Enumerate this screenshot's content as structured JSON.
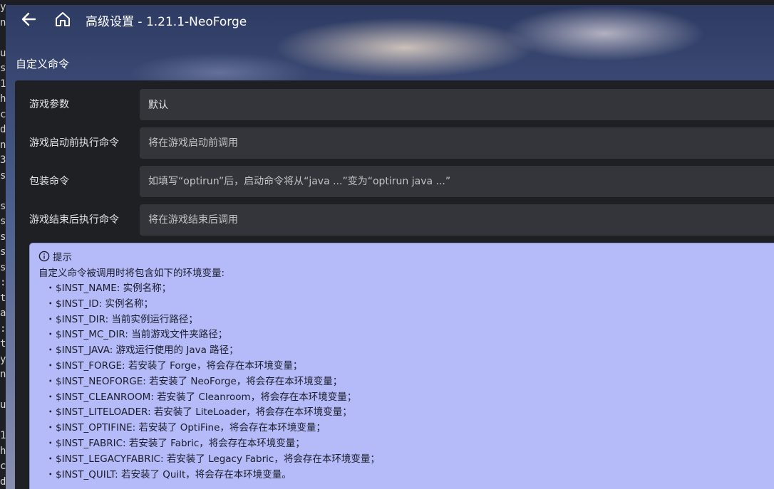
{
  "window": {
    "title": "高级设置 - 1.21.1-NeoForge"
  },
  "section": {
    "title": "自定义命令"
  },
  "fields": [
    {
      "label": "游戏参数",
      "value": "默认"
    },
    {
      "label": "游戏启动前执行命令",
      "placeholder": "将在游戏启动前调用"
    },
    {
      "label": "包装命令",
      "placeholder": "如填写“optirun”后，启动命令将从“java ...”变为“optirun java ...”"
    },
    {
      "label": "游戏结束后执行命令",
      "placeholder": "将在游戏结束后调用"
    }
  ],
  "hint": {
    "title": "提示",
    "intro": "自定义命令被调用时将包含如下的环境变量:",
    "bullet": "・",
    "items": [
      "$INST_NAME: 实例名称；",
      "$INST_ID: 实例名称；",
      "$INST_DIR: 当前实例运行路径；",
      "$INST_MC_DIR: 当前游戏文件夹路径；",
      "$INST_JAVA: 游戏运行使用的 Java 路径；",
      "$INST_FORGE: 若安装了 Forge，将会存在本环境变量；",
      "$INST_NEOFORGE: 若安装了 NeoForge，将会存在本环境变量；",
      "$INST_CLEANROOM: 若安装了 Cleanroom，将会存在本环境变量；",
      "$INST_LITELOADER: 若安装了 LiteLoader，将会存在本环境变量；",
      "$INST_OPTIFINE: 若安装了 OptiFine，将会存在本环境变量；",
      "$INST_FABRIC: 若安装了 Fabric，将会存在本环境变量；",
      "$INST_LEGACYFABRIC: 若安装了 Legacy Fabric，将会存在本环境变量；",
      "$INST_QUILT: 若安装了 Quilt，将会存在本环境变量。"
    ]
  },
  "terminal": {
    "lines": [
      "y",
      "n",
      "",
      "u",
      "s",
      "1",
      "h",
      "c",
      "d",
      "n",
      "3",
      "s",
      "",
      "s",
      "s",
      "s",
      "s",
      "s",
      ":",
      "t",
      "a",
      ":",
      "t",
      "y",
      "n",
      "",
      "u",
      "",
      "1",
      "h",
      "c",
      "d"
    ]
  },
  "colors": {
    "panel_bg": "#1f2024",
    "input_bg": "#33353b",
    "hint_bg": "#b5bbf8",
    "title_text": "#ffffff"
  },
  "icons": {
    "back": "back-arrow-icon",
    "home": "home-icon",
    "info": "info-icon"
  }
}
